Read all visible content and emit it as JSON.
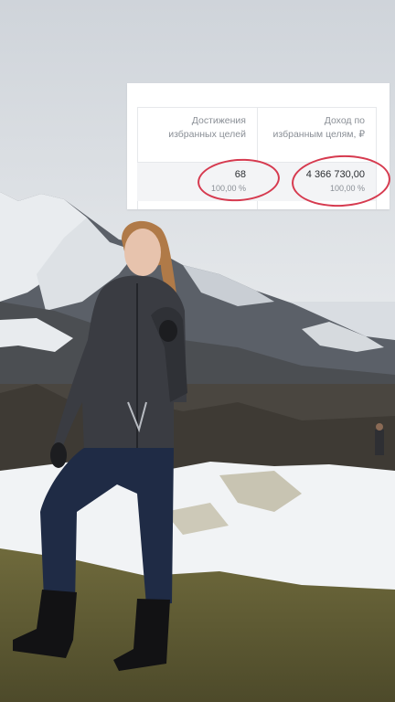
{
  "table": {
    "col1_header": "Достижения\nизбранных целей",
    "col2_header": "Доход по\nизбранным целям, ₽",
    "total_goals": "68",
    "total_goals_pct": "100,00 %",
    "total_income": "4 366 730,00",
    "total_income_pct": "100,00 %"
  },
  "colors": {
    "highlight_circle": "#d63a4f",
    "card_bg": "#ffffff",
    "total_row_bg": "#f3f4f6"
  }
}
